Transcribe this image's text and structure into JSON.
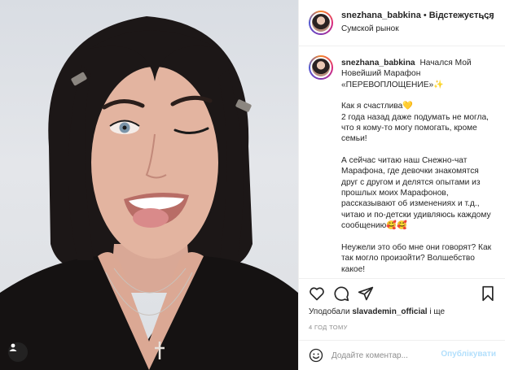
{
  "post": {
    "username": "snezhana_babkina",
    "separator": "•",
    "follow_label": "Відстежується",
    "location": "Сумской рынок",
    "more_label": "···"
  },
  "caption": {
    "username": "snezhana_babkina",
    "paragraphs": [
      "Начался Мой Новейший Марафон «ПЕРЕВОПЛОЩЕНИЕ»✨",
      "Как я счастлива💛\n2 года назад даже подумать не могла, что я кому-то могу помогать, кроме семьи!",
      "А сейчас читаю наш Снежно-чат Марафона, где девочки знакомятся друг с другом и делятся опытами из прошлых моих Марафонов, рассказывают об изменениях и т.д., читаю и по-детски удивляюсь каждому сообщению🥰🥰",
      "Неужели это обо мне они говорят? Как так могло произойти? Волшебство какое!"
    ]
  },
  "engagement": {
    "likes_prefix": "Уподобали",
    "liker": "slavademin_official",
    "likes_suffix": "і ще",
    "time_ago": "4 год тому"
  },
  "comment": {
    "placeholder": "Додайте коментар...",
    "post_label": "Опублікувати"
  },
  "icons": {
    "like": "heart-icon",
    "comment": "comment-icon",
    "share": "paper-plane-icon",
    "save": "bookmark-icon",
    "emoji": "smiley-icon",
    "tag": "person-tag-icon"
  },
  "colors": {
    "text": "#262626",
    "muted": "#8e8e8e",
    "border": "#efefef",
    "post_disabled": "#b2dffc"
  }
}
